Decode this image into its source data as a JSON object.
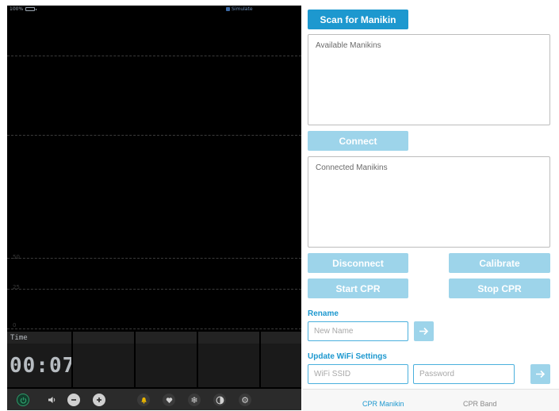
{
  "status_bar": {
    "battery": "100%",
    "app_name": "Simulate"
  },
  "monitor": {
    "axis_labels": [
      "50",
      "25",
      "0"
    ],
    "time_label": "Time",
    "time_value": "00:07",
    "controls": [
      {
        "icon": "power-icon",
        "color": "#2e9b6a"
      },
      {
        "icon": "speaker-icon",
        "color": "#d0d0d0"
      },
      {
        "icon": "minus-icon",
        "color": "#d0d0d0"
      },
      {
        "icon": "plus-icon",
        "color": "#d0d0d0"
      },
      {
        "icon": "bell-icon",
        "color": "#e8b400"
      },
      {
        "icon": "heart-icon",
        "color": "#d0d0d0"
      },
      {
        "icon": "snowflake-icon",
        "color": "#d0d0d0"
      },
      {
        "icon": "contrast-icon",
        "color": "#d0d0d0"
      },
      {
        "icon": "gear-icon",
        "color": "#d0d0d0"
      }
    ]
  },
  "controls": {
    "scan_button": "Scan for Manikin",
    "available_label": "Available Manikins",
    "connect_button": "Connect",
    "connected_label": "Connected Manikins",
    "disconnect_button": "Disconnect",
    "calibrate_button": "Calibrate",
    "start_cpr_button": "Start CPR",
    "stop_cpr_button": "Stop CPR",
    "rename": {
      "label": "Rename",
      "placeholder": "New Name"
    },
    "wifi": {
      "label": "Update WiFi Settings",
      "ssid_placeholder": "WiFi SSID",
      "password_placeholder": "Password"
    }
  },
  "tabs": [
    {
      "label": "CPR Manikin",
      "active": true
    },
    {
      "label": "CPR Band",
      "active": false
    }
  ],
  "colors": {
    "accent": "#1d98cf",
    "disabled_button": "#9dd4ea",
    "monitor_bg": "#000000"
  }
}
